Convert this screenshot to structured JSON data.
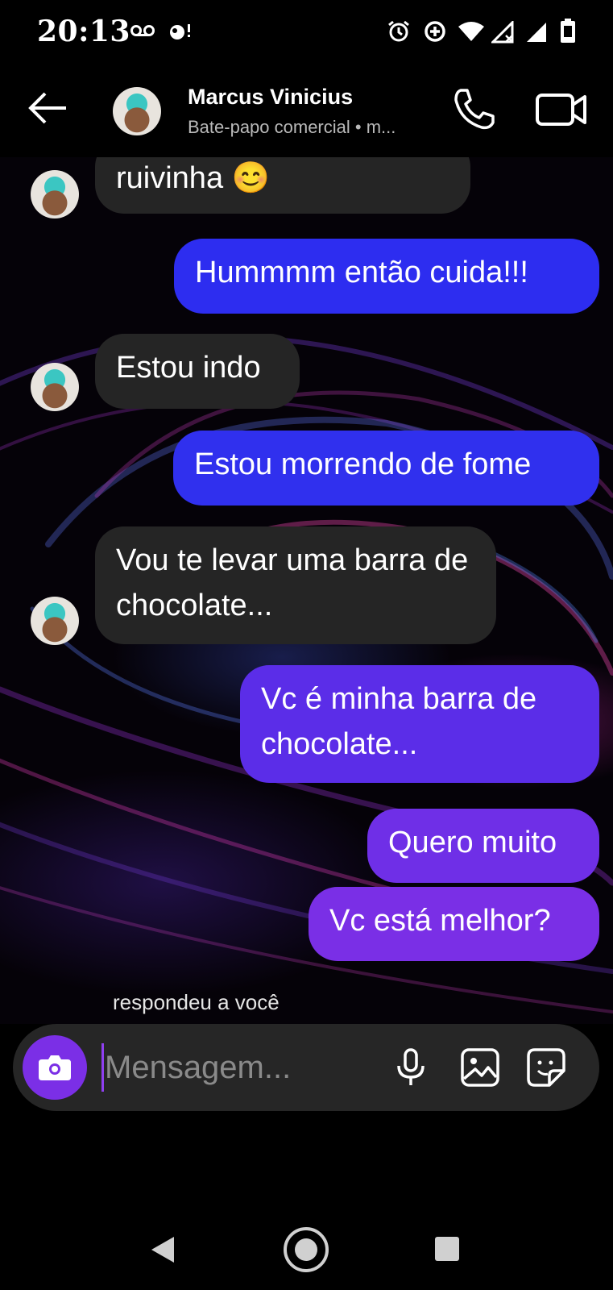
{
  "status_bar": {
    "time": "20:13"
  },
  "header": {
    "contact_name": "Marcus Vinicius",
    "contact_subtitle": "Bate-papo comercial • m..."
  },
  "messages": [
    {
      "direction": "in",
      "text": "ruivinha 😊"
    },
    {
      "direction": "out",
      "text": "Hummmm então cuida!!!"
    },
    {
      "direction": "in",
      "text": "Estou indo"
    },
    {
      "direction": "out",
      "text": "Estou morrendo de fome"
    },
    {
      "direction": "in",
      "text": "Vou te levar uma barra de chocolate..."
    },
    {
      "direction": "out",
      "text": "Vc é minha barra de chocolate..."
    },
    {
      "direction": "out",
      "text": "Quero muito"
    },
    {
      "direction": "out",
      "text": "Vc está melhor?"
    }
  ],
  "reply_note": "respondeu a você",
  "composer": {
    "placeholder": "Mensagem..."
  },
  "colors": {
    "outgoing_bubble_top": "#2d2df0",
    "outgoing_bubble_mid": "#5b2de8",
    "outgoing_bubble_bottom": "#7a2fe6",
    "incoming_bubble": "#252525",
    "camera_button": "#7b2fe6"
  },
  "icons": {
    "status": [
      "voicemail-icon",
      "notification-icon",
      "alarm-icon",
      "data-saver-icon",
      "wifi-icon",
      "signal-off-icon",
      "signal-icon",
      "battery-icon"
    ],
    "header": [
      "back-arrow-icon",
      "phone-icon",
      "video-camera-icon"
    ],
    "composer": [
      "camera-icon",
      "microphone-icon",
      "image-icon",
      "sticker-icon"
    ],
    "navigation": [
      "nav-back-icon",
      "nav-home-icon",
      "nav-recents-icon"
    ]
  }
}
